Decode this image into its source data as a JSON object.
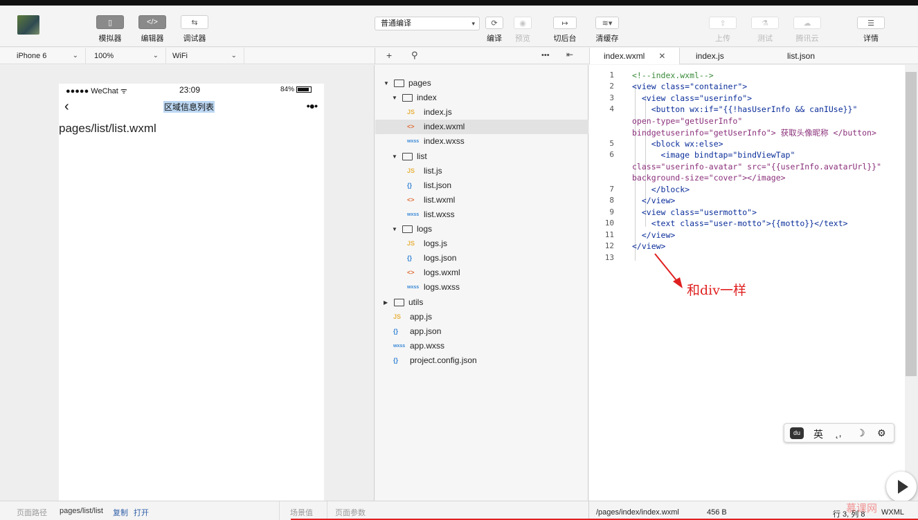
{
  "toolbar": {
    "simulator_label": "模拟器",
    "editor_label": "编辑器",
    "debugger_label": "调试器",
    "compile_mode": "普通编译",
    "compile_label": "编译",
    "preview_label": "预览",
    "background_label": "切后台",
    "clear_cache_label": "清缓存",
    "upload_label": "上传",
    "test_label": "测试",
    "cloud_label": "腾讯云",
    "details_label": "详情",
    "simulator_icon": "▯",
    "editor_icon": "</>",
    "debugger_icon": "⇆",
    "compile_icon": "⟳",
    "preview_icon": "◉",
    "background_icon": "↦",
    "clear_cache_icon": "≋▾",
    "upload_icon": "⇪",
    "test_icon": "⚗",
    "cloud_icon": "☁",
    "details_icon": "☰"
  },
  "subbar": {
    "device": "iPhone 6",
    "zoom": "100%",
    "network": "WiFi"
  },
  "phone": {
    "carrier": "●●●●● WeChat ᯤ",
    "time": "23:09",
    "battery": "84%",
    "nav_title": "区域信息列表",
    "back_icon": "‹",
    "more_icon": "•●•",
    "page_text": "pages/list/list.wxml"
  },
  "tree": {
    "items": [
      {
        "type": "folder",
        "name": "pages",
        "depth": 0,
        "open": true
      },
      {
        "type": "folder",
        "name": "index",
        "depth": 1,
        "open": true
      },
      {
        "type": "file",
        "kind": "js",
        "badge": "JS",
        "name": "index.js",
        "depth": 2
      },
      {
        "type": "file",
        "kind": "wxml",
        "badge": "<>",
        "name": "index.wxml",
        "depth": 2,
        "selected": true
      },
      {
        "type": "file",
        "kind": "wxss",
        "badge": "wxss",
        "name": "index.wxss",
        "depth": 2
      },
      {
        "type": "folder",
        "name": "list",
        "depth": 1,
        "open": true
      },
      {
        "type": "file",
        "kind": "js",
        "badge": "JS",
        "name": "list.js",
        "depth": 2
      },
      {
        "type": "file",
        "kind": "json",
        "badge": "{}",
        "name": "list.json",
        "depth": 2
      },
      {
        "type": "file",
        "kind": "wxml",
        "badge": "<>",
        "name": "list.wxml",
        "depth": 2
      },
      {
        "type": "file",
        "kind": "wxss",
        "badge": "wxss",
        "name": "list.wxss",
        "depth": 2
      },
      {
        "type": "folder",
        "name": "logs",
        "depth": 1,
        "open": true
      },
      {
        "type": "file",
        "kind": "js",
        "badge": "JS",
        "name": "logs.js",
        "depth": 2
      },
      {
        "type": "file",
        "kind": "json",
        "badge": "{}",
        "name": "logs.json",
        "depth": 2
      },
      {
        "type": "file",
        "kind": "wxml",
        "badge": "<>",
        "name": "logs.wxml",
        "depth": 2
      },
      {
        "type": "file",
        "kind": "wxss",
        "badge": "wxss",
        "name": "logs.wxss",
        "depth": 2
      },
      {
        "type": "folder",
        "name": "utils",
        "depth": 0,
        "open": false
      },
      {
        "type": "file",
        "kind": "js",
        "badge": "JS",
        "name": "app.js",
        "depth": 0
      },
      {
        "type": "file",
        "kind": "json",
        "badge": "{}",
        "name": "app.json",
        "depth": 0
      },
      {
        "type": "file",
        "kind": "wxss",
        "badge": "wxss",
        "name": "app.wxss",
        "depth": 0
      },
      {
        "type": "file",
        "kind": "json",
        "badge": "{}",
        "name": "project.config.json",
        "depth": 0
      }
    ]
  },
  "editor": {
    "tabs": [
      {
        "label": "index.wxml",
        "active": true
      },
      {
        "label": "index.js",
        "active": false
      },
      {
        "label": "list.json",
        "active": false
      }
    ],
    "line_numbers": [
      "1",
      "2",
      "3",
      "4",
      "5",
      "6",
      "7",
      "8",
      "9",
      "10",
      "11",
      "12",
      "13"
    ],
    "lines": [
      "<!--index.wxml-->",
      "<view class=\"container\">",
      "  <view class=\"userinfo\">",
      "    <button wx:if=\"{{!hasUserInfo && canIUse}}\"",
      "open-type=\"getUserInfo\"",
      "bindgetuserinfo=\"getUserInfo\"> 获取头像昵称 </button>",
      "    <block wx:else>",
      "      <image bindtap=\"bindViewTap\"",
      "class=\"userinfo-avatar\" src=\"{{userInfo.avatarUrl}}\"",
      "background-size=\"cover\"></image>",
      "    </block>",
      "  </view>",
      "  <view class=\"usermotto\">",
      "    <text class=\"user-motto\">{{motto}}</text>",
      "  </view>",
      "</view>",
      ""
    ],
    "annotation": "和div一样"
  },
  "ime": {
    "logo": "du",
    "lang": "英",
    "punct": "˛,",
    "moon": "☽",
    "gear": "⚙"
  },
  "bottom": {
    "path_label": "页面路径",
    "path_value": "pages/list/list",
    "copy": "复制",
    "open": "打开",
    "scene": "场景值",
    "params": "页面参数",
    "file_path": "/pages/index/index.wxml",
    "file_size": "456 B",
    "cursor": "行 3, 列 8",
    "lang": "WXML"
  },
  "watermark": "慕课网"
}
